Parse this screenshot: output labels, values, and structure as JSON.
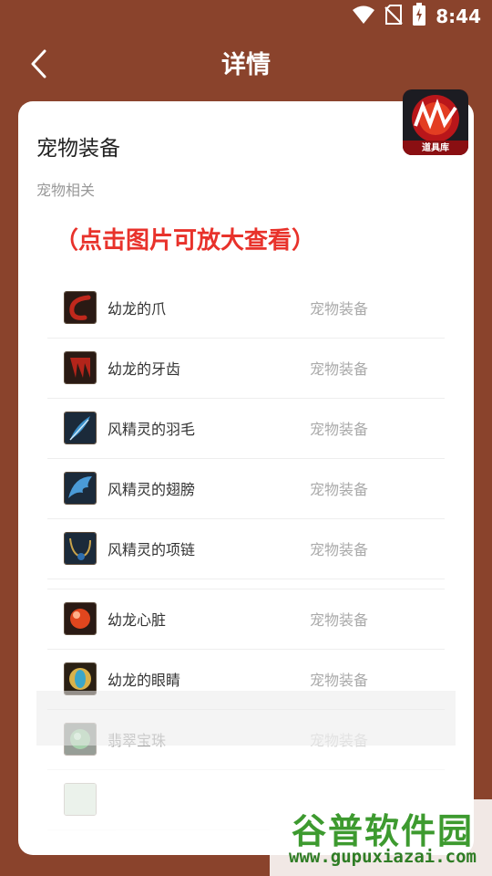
{
  "status_bar": {
    "time": "8:44",
    "icons": [
      "wifi-icon",
      "no-sim-icon",
      "battery-icon"
    ]
  },
  "header": {
    "back_icon": "chevron-left-icon",
    "title": "详情"
  },
  "detail": {
    "name": "宠物装备",
    "category": "宠物相关",
    "zoom_hint": "（点击图片可放大查看）"
  },
  "logo": {
    "banner": "道具库"
  },
  "items": [
    {
      "name": "幼龙的爪",
      "type": "宠物装备",
      "icon": "dragon-claw-icon",
      "color": "#c0281c"
    },
    {
      "name": "幼龙的牙齿",
      "type": "宠物装备",
      "icon": "dragon-fang-icon",
      "color": "#b3241a"
    },
    {
      "name": "风精灵的羽毛",
      "type": "宠物装备",
      "icon": "feather-icon",
      "color": "#3a8fc9"
    },
    {
      "name": "风精灵的翅膀",
      "type": "宠物装备",
      "icon": "wing-icon",
      "color": "#4a9ad6"
    },
    {
      "name": "风精灵的项链",
      "type": "宠物装备",
      "icon": "necklace-icon",
      "color": "#2e6fb0"
    },
    {
      "name": "幼龙心脏",
      "type": "宠物装备",
      "icon": "dragon-heart-icon",
      "color": "#e0461e"
    },
    {
      "name": "幼龙的眼睛",
      "type": "宠物装备",
      "icon": "dragon-eye-icon",
      "color": "#3ba6c8"
    },
    {
      "name": "翡翠宝珠",
      "type": "宠物装备",
      "icon": "jade-orb-icon",
      "color": "#3c9a4a"
    }
  ],
  "watermark": {
    "title": "谷普软件园",
    "url": "www.gupuxiazai.com"
  },
  "colors": {
    "background": "#8a432c",
    "card": "#ffffff",
    "hint": "#e8322b",
    "watermark": "#3d9a2f"
  }
}
